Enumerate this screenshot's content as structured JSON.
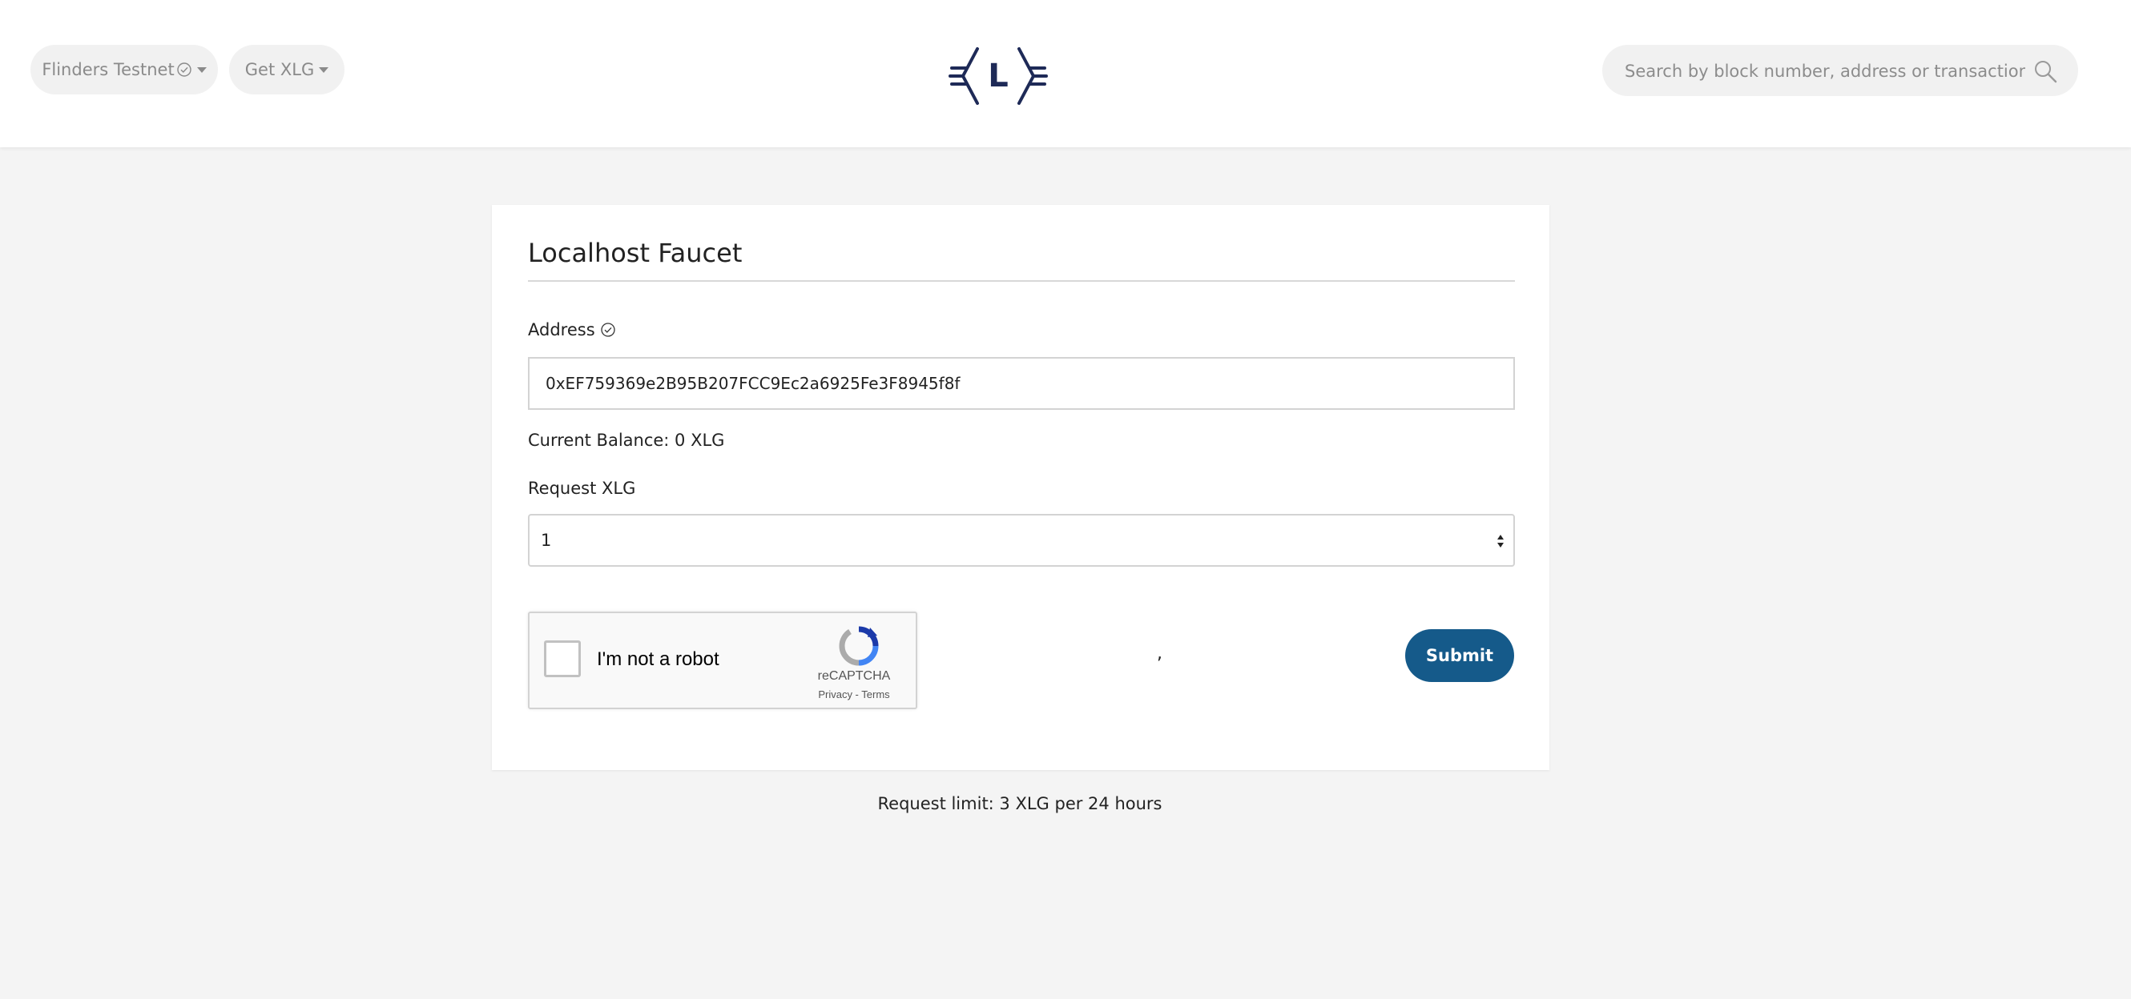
{
  "header": {
    "network_label": "Flinders Testnet",
    "get_label": "Get XLG",
    "logo_letter": "L",
    "search_placeholder": "Search by block number, address or transaction hash"
  },
  "faucet": {
    "title": "Localhost Faucet",
    "address_label": "Address",
    "address_value": "0xEF759369e2B95B207FCC9Ec2a6925Fe3F8945f8f",
    "balance_text": "Current Balance: 0 XLG",
    "request_label": "Request XLG",
    "request_value": "1",
    "separator": ",",
    "submit_label": "Submit",
    "limit_text": "Request limit: 3 XLG per 24 hours"
  },
  "captcha": {
    "label": "I'm not a robot",
    "brand": "reCAPTCHA",
    "links": "Privacy - Terms"
  },
  "colors": {
    "accent": "#155a8a",
    "logo": "#1e2a57",
    "background": "#f4f4f4"
  },
  "icons": {
    "network_status": "check-circle-icon",
    "address_status": "check-circle-icon",
    "search": "search-icon",
    "select_arrows": "up-down-arrows-icon",
    "captcha": "recaptcha-logo-icon"
  }
}
